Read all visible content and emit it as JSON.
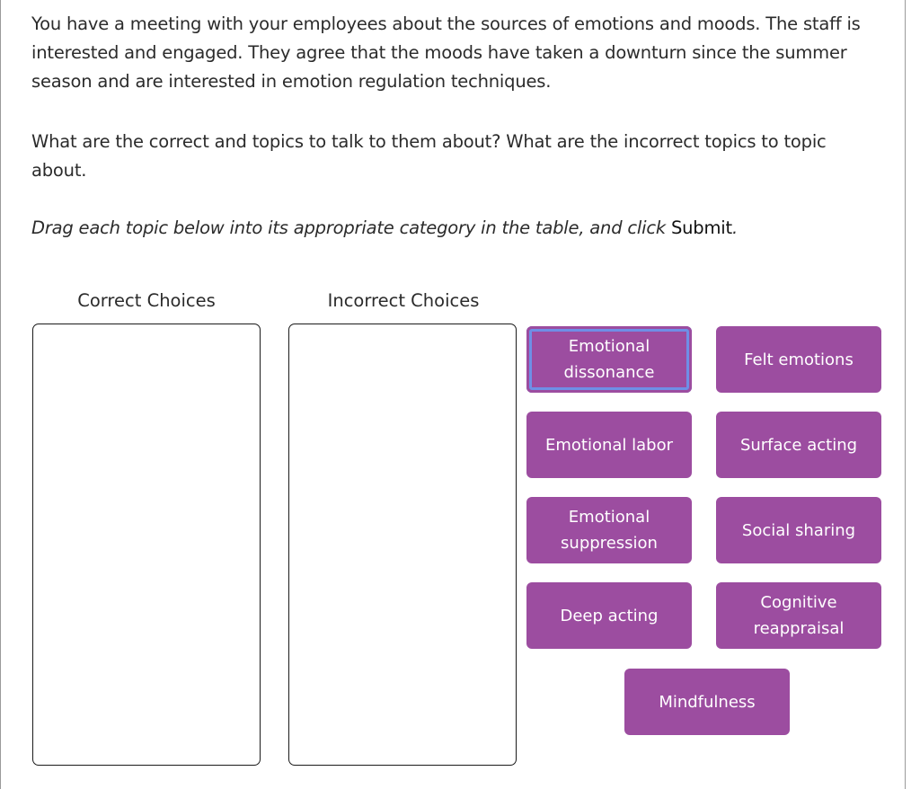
{
  "question": {
    "scenario": "You have a meeting with your employees about the sources of emotions and moods. The staff is interested and engaged. They agree that the moods have taken a downturn since the summer season and are interested in emotion regulation techniques.",
    "prompt": "What are the correct and topics to talk to them about? What are the incorrect topics to topic about.",
    "instruction_prefix": "Drag each topic below into its appropriate category in the table, and click ",
    "instruction_submit": "Submit",
    "instruction_suffix": "."
  },
  "categories": [
    {
      "label": "Correct Choices",
      "items": []
    },
    {
      "label": "Incorrect Choices",
      "items": []
    }
  ],
  "chips": [
    {
      "label": "Emotional dissonance",
      "focused": true
    },
    {
      "label": "Felt emotions"
    },
    {
      "label": "Emotional labor"
    },
    {
      "label": "Surface acting"
    },
    {
      "label": "Emotional suppression"
    },
    {
      "label": "Social sharing"
    },
    {
      "label": "Deep acting"
    },
    {
      "label": "Cognitive reappraisal"
    },
    {
      "label": "Mindfulness"
    }
  ],
  "colors": {
    "chip_bg": "#9c4da0",
    "chip_text": "#ffffff",
    "focus_ring": "#6e8fe6"
  }
}
